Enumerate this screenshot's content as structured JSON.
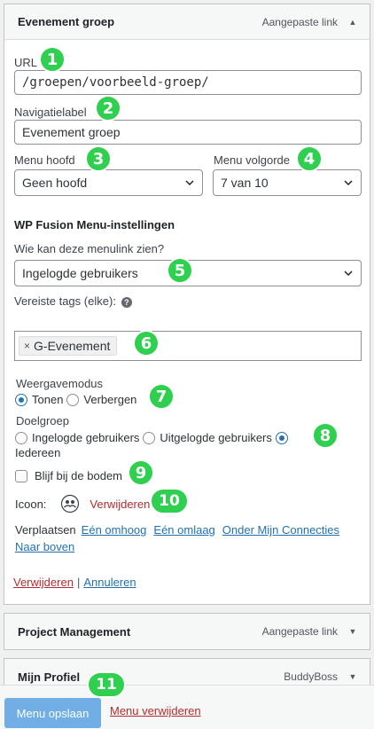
{
  "item": {
    "title": "Evenement groep",
    "type": "Aangepaste link",
    "url_label": "URL",
    "url_value": "/groepen/voorbeeld-groep/",
    "nav_label_label": "Navigatielabel",
    "nav_label_value": "Evenement groep",
    "parent_label": "Menu hoofd",
    "parent_value": "Geen hoofd",
    "order_label": "Menu volgorde",
    "order_value": "7 van 10",
    "wpf_heading": "WP Fusion Menu-instellingen",
    "visibility_question": "Wie kan deze menulink zien?",
    "visibility_value": "Ingelogde gebruikers",
    "required_tags_label": "Vereiste tags (elke):",
    "help_glyph": "?",
    "tag_remove": "×",
    "tag": "G-Evenement",
    "display_mode_label": "Weergavemodus",
    "display_show": "Tonen",
    "display_hide": "Verbergen",
    "target_label": "Doelgroep",
    "target_logged_in": "Ingelogde gebruikers",
    "target_logged_out": "Uitgelogde gebruikers",
    "target_everyone": "Iedereen",
    "sticky_label": "Blijf bij de bodem",
    "icon_label": "Icoon:",
    "icon_remove": "Verwijderen",
    "move_label": "Verplaatsen",
    "move_up": "Eén omhoog",
    "move_down": "Eén omlaag",
    "move_under": "Onder Mijn Connecties",
    "move_top": "Naar boven",
    "remove": "Verwijderen",
    "separator": "|",
    "cancel": "Annuleren"
  },
  "collapsed_items": [
    {
      "title": "Project Management",
      "type": "Aangepaste link"
    },
    {
      "title": "Mijn Profiel",
      "type": "BuddyBoss"
    }
  ],
  "footer": {
    "save": "Menu opslaan",
    "delete_menu": "Menu verwijderen"
  },
  "badges": [
    "1",
    "2",
    "3",
    "4",
    "5",
    "6",
    "7",
    "8",
    "9",
    "10",
    "11"
  ],
  "colors": {
    "primary": "#2271b1",
    "danger": "#b32d2e",
    "badge": "#2fcf4f",
    "button_disabled": "#72aee6"
  }
}
